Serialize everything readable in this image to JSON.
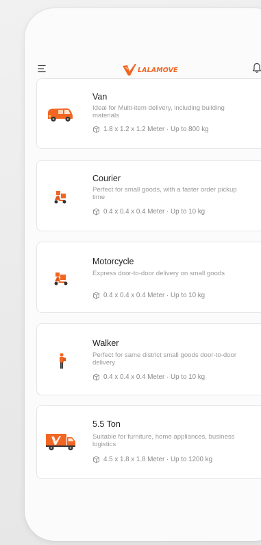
{
  "app": {
    "logo_text": "LALAMOVE",
    "brand_color": "#f16622",
    "icons": [
      "menu-icon",
      "lalamove-logo-icon",
      "bell-icon",
      "box-icon"
    ]
  },
  "vehicles": [
    {
      "name": "Van",
      "description": "Ideal for Multi-item delivery, including building materials",
      "spec": "1.8 x 1.2 x 1.2 Meter · Up to 800 kg",
      "icon": "van-icon"
    },
    {
      "name": "Courier",
      "description": "Perfect for small goods, with a faster order pickup time",
      "spec": "0.4 x 0.4 x 0.4 Meter · Up to 10 kg",
      "icon": "courier-scooter-icon"
    },
    {
      "name": "Motorcycle",
      "description": "Express door-to-door delivery on small goods",
      "spec": "0.4 x 0.4 x 0.4 Meter · Up to 10 kg",
      "icon": "motorcycle-icon"
    },
    {
      "name": "Walker",
      "description": "Perfect for same district small goods door-to-door delivery",
      "spec": "0.4 x 0.4 x 0.4 Meter · Up to 10 kg",
      "icon": "walker-icon"
    },
    {
      "name": "5.5 Ton",
      "description": "Suitable for furniture, home appliances, business logistics",
      "spec": "4.5 x 1.8 x 1.8 Meter · Up to 1200 kg",
      "icon": "truck-icon"
    }
  ]
}
